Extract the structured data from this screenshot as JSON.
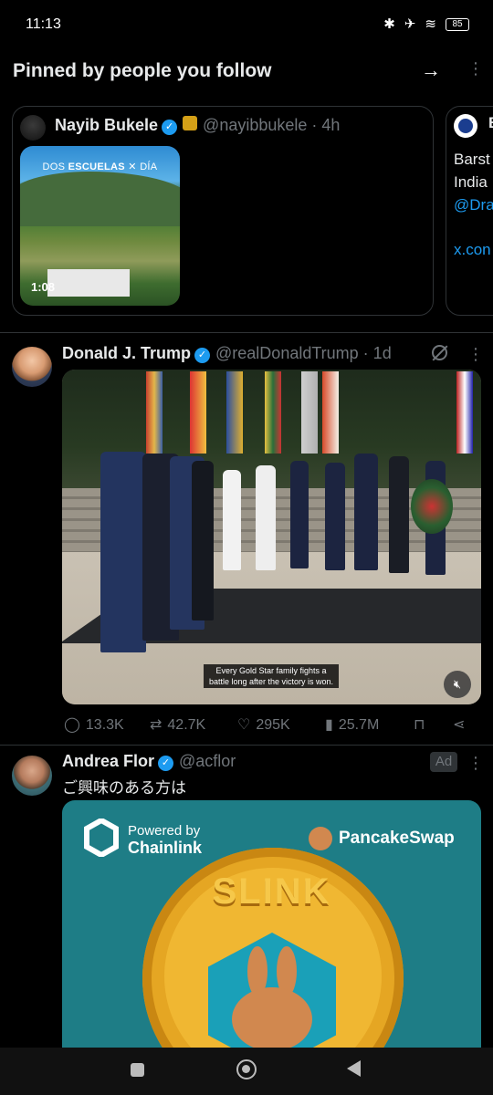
{
  "status_bar": {
    "time": "11:13",
    "battery": "85",
    "icons": [
      "bluetooth-icon",
      "airplane-icon",
      "wifi-icon",
      "battery-icon"
    ]
  },
  "pinned": {
    "title": "Pinned by people you follow",
    "card1": {
      "name": "Nayib Bukele",
      "handle": "@nayibbukele · 4h",
      "video_caption_a": "DOS ",
      "video_caption_b": "ESCUELAS",
      "video_caption_c": "DÍA",
      "duration": "1:08"
    },
    "card2": {
      "name_initial": "B",
      "line1": "Barst",
      "line2": "India",
      "link1": "@Dra",
      "link2": "x.con"
    }
  },
  "tweet1": {
    "name": "Donald J. Trump",
    "handle": "@realDonaldTrump · 1d",
    "subtitle": "Every Gold Star family fights a battle long after the victory is won.",
    "stats": {
      "replies": "13.3K",
      "reposts": "42.7K",
      "likes": "295K",
      "views": "25.7M"
    }
  },
  "tweet2": {
    "name": "Andrea Flor",
    "handle": "@acflor",
    "ad_label": "Ad",
    "text": "ご興味のある方は",
    "ad_image": {
      "powered_by": "Powered by",
      "chainlink": "Chainlink",
      "brand": "PancakeSwap",
      "coin": "SLINK"
    }
  },
  "colors": {
    "background": "#000000",
    "accent": "#1d9bf0",
    "muted": "#71767b",
    "divider": "#2f3336"
  }
}
